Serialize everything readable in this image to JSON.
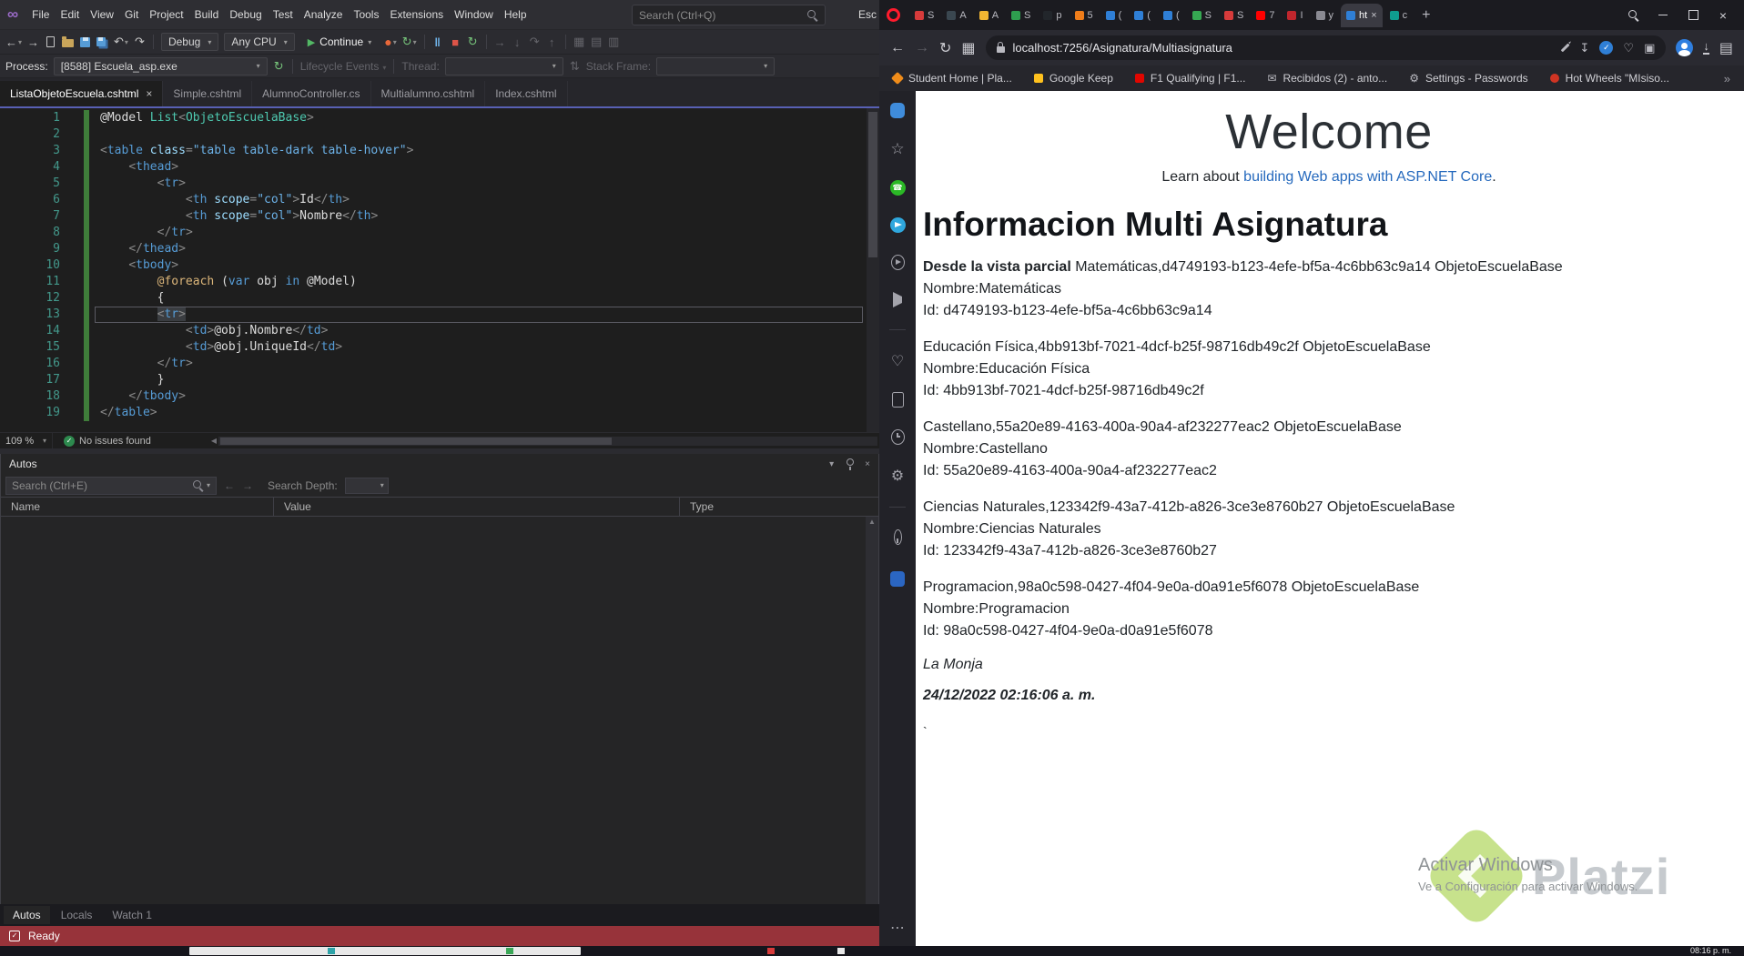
{
  "vs": {
    "menus": [
      "File",
      "Edit",
      "View",
      "Git",
      "Project",
      "Build",
      "Debug",
      "Test",
      "Analyze",
      "Tools",
      "Extensions",
      "Window",
      "Help"
    ],
    "search_placeholder": "Search (Ctrl+Q)",
    "solution_badge": "Esc",
    "toolbar": {
      "config": "Debug",
      "platform": "Any CPU",
      "continue_label": "Continue",
      "process_label": "Process:",
      "process_value": "[8588] Escuela_asp.exe",
      "lifecycle_label": "Lifecycle Events",
      "thread_label": "Thread:",
      "stackframe_label": "Stack Frame:"
    },
    "doc_tabs": [
      {
        "label": "ListaObjetoEscuela.cshtml",
        "active": true
      },
      {
        "label": "Simple.cshtml"
      },
      {
        "label": "AlumnoController.cs"
      },
      {
        "label": "Multialumno.cshtml"
      },
      {
        "label": "Index.cshtml"
      }
    ],
    "editor": {
      "zoom": "109 %",
      "issues": "No issues found",
      "lines": [
        {
          "s": [
            [
              "d",
              "@Model "
            ],
            [
              "t",
              "List"
            ],
            [
              "p",
              "<"
            ],
            [
              "t",
              "ObjetoEscuelaBase"
            ],
            [
              "p",
              ">"
            ]
          ]
        },
        {
          "s": []
        },
        {
          "s": [
            [
              "p",
              "<"
            ],
            [
              "k",
              "table"
            ],
            [
              "d",
              " "
            ],
            [
              "a",
              "class"
            ],
            [
              "p",
              "="
            ],
            [
              "s",
              "\"table table-dark table-hover\""
            ],
            [
              "p",
              ">"
            ]
          ]
        },
        {
          "s": [
            [
              "d",
              "    "
            ],
            [
              "p",
              "<"
            ],
            [
              "k",
              "thead"
            ],
            [
              "p",
              ">"
            ]
          ]
        },
        {
          "s": [
            [
              "d",
              "        "
            ],
            [
              "p",
              "<"
            ],
            [
              "k",
              "tr"
            ],
            [
              "p",
              ">"
            ]
          ]
        },
        {
          "s": [
            [
              "d",
              "            "
            ],
            [
              "p",
              "<"
            ],
            [
              "k",
              "th"
            ],
            [
              "d",
              " "
            ],
            [
              "a",
              "scope"
            ],
            [
              "p",
              "="
            ],
            [
              "s",
              "\"col\""
            ],
            [
              "p",
              ">"
            ],
            [
              "d",
              "Id"
            ],
            [
              "p",
              "</"
            ],
            [
              "k",
              "th"
            ],
            [
              "p",
              ">"
            ]
          ]
        },
        {
          "s": [
            [
              "d",
              "            "
            ],
            [
              "p",
              "<"
            ],
            [
              "k",
              "th"
            ],
            [
              "d",
              " "
            ],
            [
              "a",
              "scope"
            ],
            [
              "p",
              "="
            ],
            [
              "s",
              "\"col\""
            ],
            [
              "p",
              ">"
            ],
            [
              "d",
              "Nombre"
            ],
            [
              "p",
              "</"
            ],
            [
              "k",
              "th"
            ],
            [
              "p",
              ">"
            ]
          ]
        },
        {
          "s": [
            [
              "d",
              "        "
            ],
            [
              "p",
              "</"
            ],
            [
              "k",
              "tr"
            ],
            [
              "p",
              ">"
            ]
          ]
        },
        {
          "s": [
            [
              "d",
              "    "
            ],
            [
              "p",
              "</"
            ],
            [
              "k",
              "thead"
            ],
            [
              "p",
              ">"
            ]
          ]
        },
        {
          "s": [
            [
              "d",
              "    "
            ],
            [
              "p",
              "<"
            ],
            [
              "k",
              "tbody"
            ],
            [
              "p",
              ">"
            ]
          ]
        },
        {
          "s": [
            [
              "d",
              "        "
            ],
            [
              "r",
              "@foreach"
            ],
            [
              "d",
              " ("
            ],
            [
              "k",
              "var"
            ],
            [
              "d",
              " obj "
            ],
            [
              "k",
              "in"
            ],
            [
              "d",
              " @Model)"
            ]
          ]
        },
        {
          "s": [
            [
              "d",
              "        {"
            ]
          ]
        },
        {
          "cur": 1,
          "s": [
            [
              "d",
              "        "
            ],
            [
              "p",
              "<",
              1
            ],
            [
              "k",
              "tr",
              1
            ],
            [
              "p",
              ">",
              1
            ]
          ]
        },
        {
          "s": [
            [
              "d",
              "            "
            ],
            [
              "p",
              "<"
            ],
            [
              "k",
              "td"
            ],
            [
              "p",
              ">"
            ],
            [
              "d",
              "@obj.Nombre"
            ],
            [
              "p",
              "</"
            ],
            [
              "k",
              "td"
            ],
            [
              "p",
              ">"
            ]
          ]
        },
        {
          "s": [
            [
              "d",
              "            "
            ],
            [
              "p",
              "<"
            ],
            [
              "k",
              "td"
            ],
            [
              "p",
              ">"
            ],
            [
              "d",
              "@obj.UniqueId"
            ],
            [
              "p",
              "</"
            ],
            [
              "k",
              "td"
            ],
            [
              "p",
              ">"
            ]
          ]
        },
        {
          "s": [
            [
              "d",
              "        "
            ],
            [
              "p",
              "</"
            ],
            [
              "k",
              "tr"
            ],
            [
              "p",
              ">"
            ]
          ]
        },
        {
          "s": [
            [
              "d",
              "        }"
            ]
          ]
        },
        {
          "s": [
            [
              "d",
              "    "
            ],
            [
              "p",
              "</"
            ],
            [
              "k",
              "tbody"
            ],
            [
              "p",
              ">"
            ]
          ]
        },
        {
          "s": [
            [
              "p",
              "</"
            ],
            [
              "k",
              "table"
            ],
            [
              "p",
              ">"
            ]
          ]
        }
      ]
    },
    "autos": {
      "title": "Autos",
      "search_placeholder": "Search (Ctrl+E)",
      "depth_label": "Search Depth:",
      "columns": [
        "Name",
        "Value",
        "Type"
      ],
      "tabs": [
        "Autos",
        "Locals",
        "Watch 1"
      ]
    },
    "status_text": "Ready"
  },
  "browser": {
    "tabs": [
      {
        "l": "S",
        "c": "#d63b3b"
      },
      {
        "l": "A",
        "c": "#3a4750"
      },
      {
        "l": "A",
        "c": "#f2b632"
      },
      {
        "l": "S",
        "c": "#2e9e4f"
      },
      {
        "l": "p",
        "c": "#22262b"
      },
      {
        "l": "5",
        "c": "#ef7d1a"
      },
      {
        "l": "(",
        "c": "#2f7fd6"
      },
      {
        "l": "(",
        "c": "#2f7fd6"
      },
      {
        "l": "(",
        "c": "#2f7fd6"
      },
      {
        "l": "S",
        "c": "#36a852"
      },
      {
        "l": "S",
        "c": "#d63b3b"
      },
      {
        "l": "7",
        "c": "#ff0000"
      },
      {
        "l": "I",
        "c": "#c0262d"
      },
      {
        "l": "y",
        "c": "#8a8a92"
      },
      {
        "l": "ht",
        "c": "#2f7fd6",
        "active": true
      },
      {
        "l": "c",
        "c": "#0f9d8f"
      }
    ],
    "url": "localhost:7256/Asignatura/Multiasignatura",
    "bookmarks": [
      {
        "label": "Student Home | Pla...",
        "icon": {
          "kind": "diamond",
          "color": "#f08c1a"
        }
      },
      {
        "label": "Google Keep",
        "icon": {
          "kind": "square",
          "color": "#ffc11e"
        }
      },
      {
        "label": "F1 Qualifying | F1...",
        "icon": {
          "kind": "square",
          "color": "#e10600"
        }
      },
      {
        "label": "Recibidos (2) - anto...",
        "icon": {
          "kind": "glyph",
          "char": "✉",
          "color": "#b9b9c0"
        }
      },
      {
        "label": "Settings - Passwords",
        "icon": {
          "kind": "glyph",
          "char": "⚙",
          "color": "#b9b9c0"
        }
      },
      {
        "label": "Hot Wheels \"MIsiso...",
        "icon": {
          "kind": "circle",
          "color": "#cf3423"
        }
      }
    ],
    "sidebar": [
      {
        "name": "workspace-icon",
        "type": "workspace"
      },
      {
        "name": "bookmarks-star-icon",
        "type": "star",
        "glyph": "☆"
      },
      {
        "name": "whatsapp-icon",
        "type": "whatsapp",
        "glyph": "☎"
      },
      {
        "name": "telegram-icon",
        "type": "telegram"
      },
      {
        "name": "player-icon",
        "type": "player"
      },
      {
        "name": "messenger-icon",
        "type": "send"
      },
      {
        "type": "divider"
      },
      {
        "name": "likes-icon",
        "type": "heart",
        "glyph": "♡"
      },
      {
        "name": "my-flow-icon",
        "type": "device"
      },
      {
        "name": "history-icon",
        "type": "clock"
      },
      {
        "name": "settings-icon",
        "type": "gear",
        "glyph": "⚙"
      },
      {
        "type": "divider"
      },
      {
        "name": "pinboards-icon",
        "type": "pin"
      },
      {
        "name": "pinned-app-icon",
        "type": "bluesq"
      },
      {
        "name": "sidebar-setup-icon",
        "type": "dots",
        "glyph": "⋯",
        "bottom": true
      }
    ],
    "page": {
      "welcome": "Welcome",
      "learn_prefix": "Learn about ",
      "learn_link": "building Web apps with ASP.NET Core",
      "learn_suffix": ".",
      "heading": "Informacion Multi Asignatura",
      "records": [
        {
          "lead": "Desde la vista parcial ",
          "summary": "Matemáticas,d4749193-b123-4efe-bf5a-4c6bb63c9a14 ObjetoEscuelaBase",
          "nombre": "Nombre:Matemáticas",
          "id": "Id: d4749193-b123-4efe-bf5a-4c6bb63c9a14"
        },
        {
          "lead": "",
          "summary": "Educación Física,4bb913bf-7021-4dcf-b25f-98716db49c2f ObjetoEscuelaBase",
          "nombre": "Nombre:Educación Física",
          "id": "Id: 4bb913bf-7021-4dcf-b25f-98716db49c2f"
        },
        {
          "lead": "",
          "summary": "Castellano,55a20e89-4163-400a-90a4-af232277eac2 ObjetoEscuelaBase",
          "nombre": "Nombre:Castellano",
          "id": "Id: 55a20e89-4163-400a-90a4-af232277eac2"
        },
        {
          "lead": "",
          "summary": "Ciencias Naturales,123342f9-43a7-412b-a826-3ce3e8760b27 ObjetoEscuelaBase",
          "nombre": "Nombre:Ciencias Naturales",
          "id": "Id: 123342f9-43a7-412b-a826-3ce3e8760b27"
        },
        {
          "lead": "",
          "summary": "Programacion,98a0c598-0427-4f04-9e0a-d0a91e5f6078 ObjetoEscuelaBase",
          "nombre": "Nombre:Programacion",
          "id": "Id: 98a0c598-0427-4f04-9e0a-d0a91e5f6078"
        }
      ],
      "footer_name": "La Monja",
      "footer_date": "24/12/2022 02:16:06 a. m.",
      "stray_char": "`",
      "watermark_title": "Activar Windows",
      "watermark_sub": "Ve a Configuración para activar Windows.",
      "brand": "Platzi",
      "brand_color": "#9bcc2f",
      "link_color": "#2569bd"
    }
  },
  "taskbar": {
    "clock": "08:16 p. m."
  }
}
